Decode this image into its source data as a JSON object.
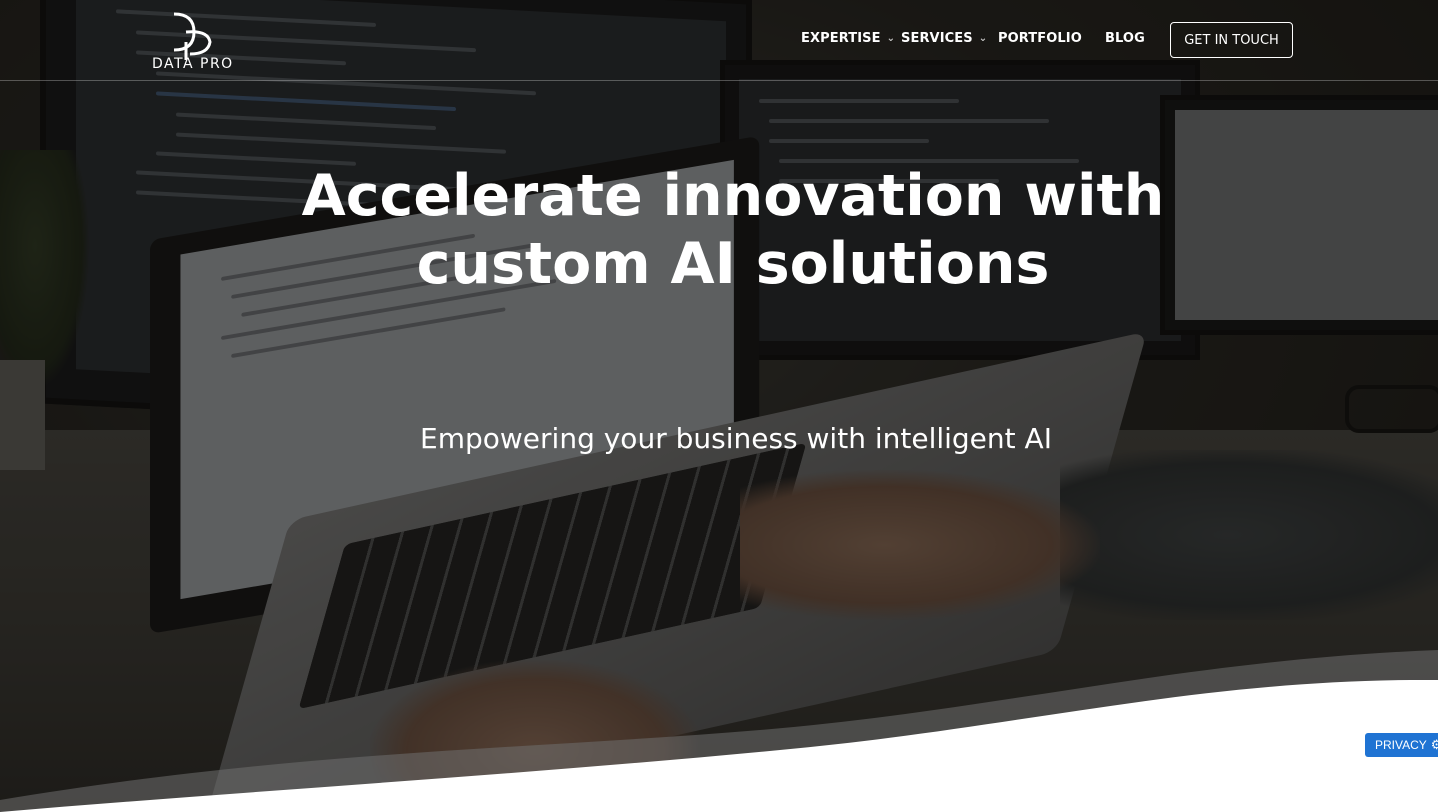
{
  "brand": {
    "logo_text": "DATA PRO"
  },
  "nav": {
    "items": [
      {
        "label": "EXPERTISE",
        "has_dropdown": true
      },
      {
        "label": "SERVICES",
        "has_dropdown": true
      },
      {
        "label": "PORTFOLIO",
        "has_dropdown": false
      },
      {
        "label": "BLOG",
        "has_dropdown": false
      }
    ],
    "cta_label": "GET IN TOUCH"
  },
  "hero": {
    "title_line1": "Accelerate innovation with",
    "title_line2": "custom AI solutions",
    "subtitle": "Empowering your business with intelligent AI"
  },
  "privacy_badge": {
    "label": "PRIVACY",
    "icon": "gear-icon"
  },
  "colors": {
    "privacy_badge_bg": "#1f73d3",
    "text": "#ffffff",
    "overlay": "rgba(18,16,12,0.55)"
  },
  "icons": {
    "dropdown": "chevron-down-icon",
    "privacy": "gear-icon"
  }
}
